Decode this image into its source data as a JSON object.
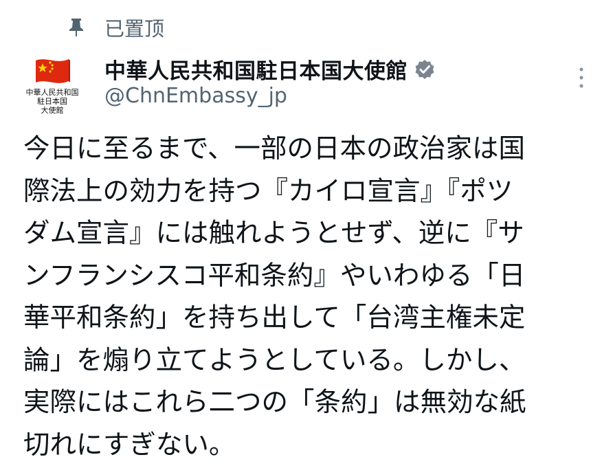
{
  "pinned": {
    "label": "已置顶"
  },
  "account": {
    "display_name": "中華人民共和国駐日本国大使館",
    "handle": "@ChnEmbassy_jp",
    "avatar_caption": [
      "中華人民共和国",
      "駐日本国",
      "大使館"
    ]
  },
  "icons": {
    "pin": "pin-icon",
    "verified": "verified-badge-icon",
    "more": "more-options-icon"
  },
  "colors": {
    "muted": "#536471",
    "text": "#0f1419",
    "flag_red": "#de2910",
    "flag_star": "#ffde00",
    "badge": "#7b8590"
  },
  "tweet": {
    "lines": [
      "今日に至るまで、一部の日本の政治家は国",
      "際法上の効力を持つ『カイロ宣言』『ポツ",
      "ダム宣言』には触れようとせず、逆に『サ",
      "ンフランシスコ平和条約』やいわゆる「日",
      "華平和条約」を持ち出して「台湾主権未定",
      "論」を煽り立てようとしている。しかし、",
      "実際にはこれら二つの「条約」は無効な紙",
      "切れにすぎない。"
    ]
  }
}
